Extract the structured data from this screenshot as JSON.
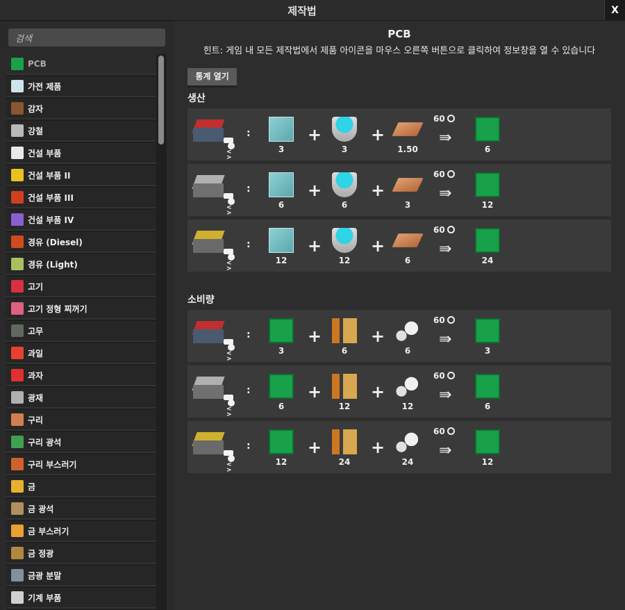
{
  "window": {
    "title": "제작법",
    "close_label": "X"
  },
  "search": {
    "placeholder": "검색"
  },
  "sidebar": {
    "items": [
      {
        "label": "PCB",
        "icon": "pcb-icon",
        "color": "#1aa14c"
      },
      {
        "label": "가전 제품",
        "icon": "appliance-icon",
        "color": "#cfe3ea"
      },
      {
        "label": "감자",
        "icon": "potato-icon",
        "color": "#8a5530"
      },
      {
        "label": "강철",
        "icon": "steel-icon",
        "color": "#b9b9b9"
      },
      {
        "label": "건설 부품",
        "icon": "construction-part-icon",
        "color": "#e8e8e8"
      },
      {
        "label": "건설 부품 II",
        "icon": "construction-part-2-icon",
        "color": "#e8c020"
      },
      {
        "label": "건설 부품 III",
        "icon": "construction-part-3-icon",
        "color": "#d04020"
      },
      {
        "label": "건설 부품 IV",
        "icon": "construction-part-4-icon",
        "color": "#8a60d0"
      },
      {
        "label": "경유 (Diesel)",
        "icon": "diesel-icon",
        "color": "#d04a20"
      },
      {
        "label": "경유 (Light)",
        "icon": "light-oil-icon",
        "color": "#a8c060"
      },
      {
        "label": "고기",
        "icon": "meat-icon",
        "color": "#d83040"
      },
      {
        "label": "고기 정형 찌꺼기",
        "icon": "meat-trimmings-icon",
        "color": "#e06080"
      },
      {
        "label": "고무",
        "icon": "rubber-icon",
        "color": "#606860"
      },
      {
        "label": "과일",
        "icon": "fruit-icon",
        "color": "#e84030"
      },
      {
        "label": "과자",
        "icon": "snack-icon",
        "color": "#e03030"
      },
      {
        "label": "광재",
        "icon": "slag-icon",
        "color": "#b0b0b0"
      },
      {
        "label": "구리",
        "icon": "copper-icon",
        "color": "#d08050"
      },
      {
        "label": "구리 광석",
        "icon": "copper-ore-icon",
        "color": "#40a050"
      },
      {
        "label": "구리 부스러기",
        "icon": "copper-scrap-icon",
        "color": "#d06030"
      },
      {
        "label": "금",
        "icon": "gold-icon",
        "color": "#e8b030"
      },
      {
        "label": "금 광석",
        "icon": "gold-ore-icon",
        "color": "#b09060"
      },
      {
        "label": "금 부스러기",
        "icon": "gold-scrap-icon",
        "color": "#e8a030"
      },
      {
        "label": "금 정광",
        "icon": "gold-concentrate-icon",
        "color": "#b08840"
      },
      {
        "label": "금광 분말",
        "icon": "gold-powder-icon",
        "color": "#8090a0"
      },
      {
        "label": "기계 부품",
        "icon": "machine-part-icon",
        "color": "#d0d0d0"
      }
    ]
  },
  "main": {
    "title": "PCB",
    "hint": "힌트: 게임 내 모든 제작법에서 제품 아이콘을 마우스 오른쪽 버튼으로 클릭하여 정보창을 열 수 있습니다",
    "stats_button": "통계 열기",
    "production_title": "생산",
    "consumption_title": "소비량",
    "production": [
      {
        "tier": 1,
        "inputs": [
          "3",
          "3",
          "1.50"
        ],
        "time": "60",
        "output": "6"
      },
      {
        "tier": 2,
        "inputs": [
          "6",
          "6",
          "3"
        ],
        "time": "60",
        "output": "12"
      },
      {
        "tier": 3,
        "inputs": [
          "12",
          "12",
          "6"
        ],
        "time": "60",
        "output": "24"
      }
    ],
    "consumption": [
      {
        "tier": 1,
        "inputs": [
          "3",
          "6",
          "6"
        ],
        "time": "60",
        "output": "3"
      },
      {
        "tier": 2,
        "inputs": [
          "6",
          "12",
          "12"
        ],
        "time": "60",
        "output": "6"
      },
      {
        "tier": 3,
        "inputs": [
          "12",
          "24",
          "24"
        ],
        "time": "60",
        "output": "12"
      }
    ],
    "production_icons": [
      "glass-icon",
      "bowl-icon",
      "copper-plank-icon",
      "pcb-icon"
    ],
    "consumption_icons": [
      "pcb-icon",
      "wire-icon",
      "stone-icon",
      "circuit-board-icon"
    ],
    "separator": ":",
    "plus": "+"
  }
}
